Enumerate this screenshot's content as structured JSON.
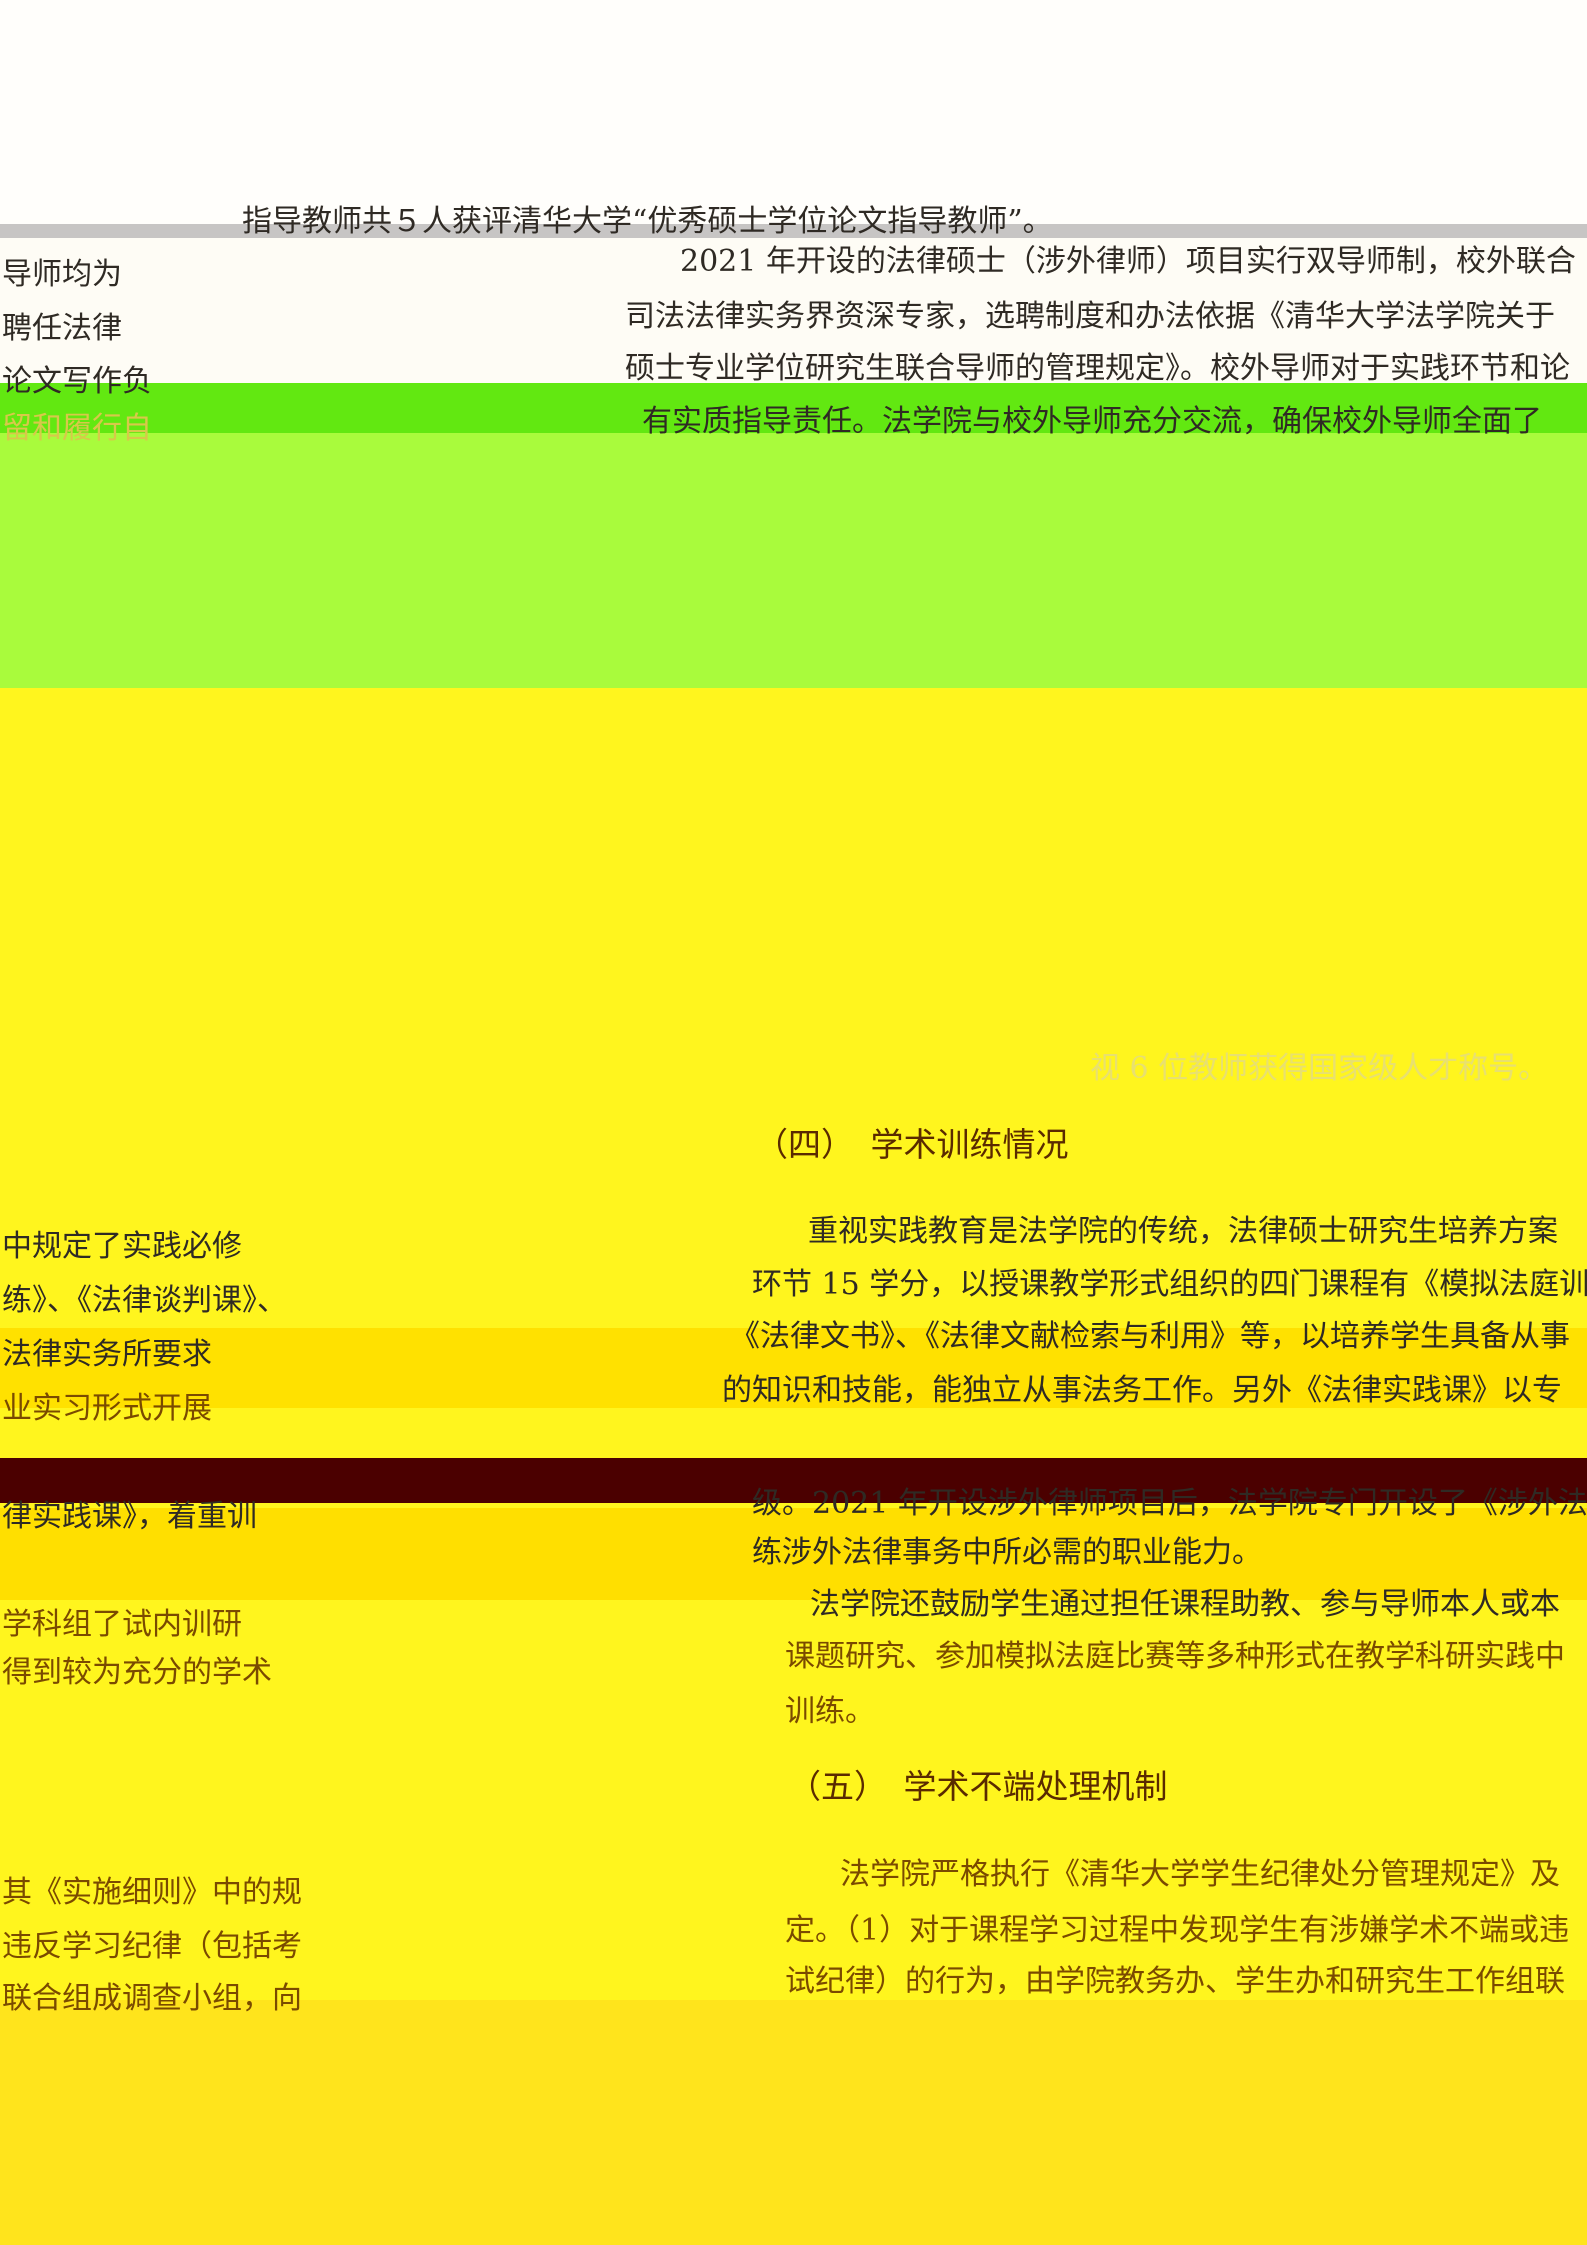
{
  "top_line": "指导教师共５人获评清华大学“优秀硕士学位论文指导教师”。",
  "left_column": {
    "lines": [
      "导师均为",
      "聘任法律",
      "论文写作负",
      "留和履行自",
      "中规定了实践必修",
      "练》、《法律谈判课》、",
      "法律实务所要求",
      "业实习形式开展",
      "律实践课》，着重训",
      "学科组了试内训研",
      "得到较为充分的学术",
      "其《实施细则》中的规",
      "违反学习纪律（包括考",
      "联合组成调查小组，向"
    ]
  },
  "right_column": {
    "para1": [
      "2021 年开设的法律硕士（涉外律师）项目实行双导师制，校外联合",
      "司法法律实务界资深专家，选聘制度和办法依据《清华大学法学院关于",
      "硕士专业学位研究生联合导师的管理规定》。校外导师对于实践环节和论",
      "有实质指导责任。法学院与校外导师充分交流，确保校外导师全面了"
    ],
    "faded_line": "视 6 位教师获得国家级人才称号。",
    "section4_heading": "（四）　学术训练情况",
    "para2": [
      "重视实践教育是法学院的传统，法律硕士研究生培养方案",
      "环节 15 学分，以授课教学形式组织的四门课程有《模拟法庭训",
      "《法律文书》、《法律文献检索与利用》等，以培养学生具备从事",
      "的知识和技能，能独立从事法务工作。另外《法律实践课》以专",
      "级。2021 年开设涉外律师项目后，法学院专门开设了《涉外法",
      "练涉外法律事务中所必需的职业能力。"
    ],
    "para3": [
      "法学院还鼓励学生通过担任课程助教、参与导师本人或本",
      "课题研究、参加模拟法庭比赛等多种形式在教学科研实践中",
      "训练。"
    ],
    "section5_heading": "（五）　学术不端处理机制",
    "para4": [
      "法学院严格执行《清华大学学生纪律处分管理规定》及",
      "定。（1）对于课程学习过程中发现学生有涉嫌学术不端或违",
      "试纪律）的行为，由学院教务办、学生办和研究生工作组联"
    ]
  }
}
